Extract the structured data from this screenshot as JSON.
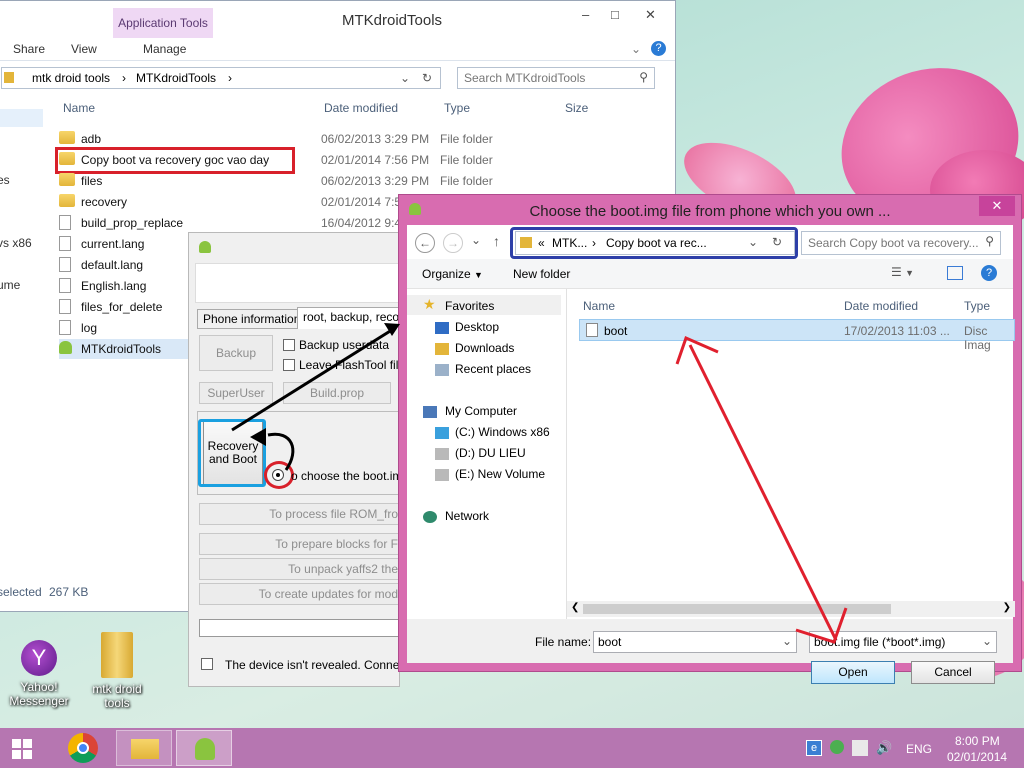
{
  "explorer": {
    "app_tools": "Application Tools",
    "title": "MTKdroidTools",
    "ribbon": {
      "share": "Share",
      "view": "View",
      "manage": "Manage"
    },
    "breadcrumb": {
      "part1": "mtk droid tools",
      "part2": "MTKdroidTools"
    },
    "search_placeholder": "Search MTKdroidTools",
    "columns": {
      "name": "Name",
      "date": "Date modified",
      "type": "Type",
      "size": "Size"
    },
    "rows": [
      {
        "name": "adb",
        "date": "06/02/2013 3:29 PM",
        "type": "File folder"
      },
      {
        "name": "Copy boot va recovery goc vao day",
        "date": "02/01/2014 7:56 PM",
        "type": "File folder"
      },
      {
        "name": "files",
        "date": "06/02/2013 3:29 PM",
        "type": "File folder"
      },
      {
        "name": "recovery",
        "date": "02/01/2014 7:5",
        "type": ""
      },
      {
        "name": "build_prop_replace",
        "date": "16/04/2012 9:4",
        "type": ""
      },
      {
        "name": "current.lang",
        "date": "",
        "type": ""
      },
      {
        "name": "default.lang",
        "date": "",
        "type": ""
      },
      {
        "name": "English.lang",
        "date": "",
        "type": ""
      },
      {
        "name": "files_for_delete",
        "date": "",
        "type": ""
      },
      {
        "name": "log",
        "date": "",
        "type": ""
      },
      {
        "name": "MTKdroidTools",
        "date": "",
        "type": ""
      }
    ],
    "side_cut": {
      "a": "es",
      "b": "vs x86",
      "c": "ume"
    },
    "status": {
      "selected": "selected",
      "size": "267 KB"
    }
  },
  "mtk": {
    "tabs": {
      "phone_info": "Phone information",
      "root": "root, backup, recove"
    },
    "backup": "Backup",
    "cb_userdata": "Backup userdata",
    "cb_flashtool": "Leave FlashTool files",
    "superuser": "SuperUser",
    "buildprop": "Build.prop",
    "recovery_boot_1": "Recovery",
    "recovery_boot_2": "and Boot",
    "choose_text": "o choose the boot.img",
    "process_rom": "To process file ROM_fro",
    "prepare_blocks": "To prepare blocks for F",
    "unpack": "To unpack yaffs2 the",
    "create_updates": "To create updates for mod",
    "device_status": "The device isn't revealed. Connect o"
  },
  "dialog": {
    "title": "Choose the boot.img file from phone which you own ...",
    "close": "✕",
    "path_prefix": "«",
    "path_1": "MTK...",
    "path_2": "Copy boot va rec...",
    "search_placeholder": "Search Copy boot va recovery...",
    "organize": "Organize",
    "new_folder": "New folder",
    "nav": {
      "favorites": "Favorites",
      "desktop": "Desktop",
      "downloads": "Downloads",
      "recent": "Recent places",
      "mycomputer": "My Computer",
      "c": "(C:) Windows x86",
      "d": "(D:) DU LIEU",
      "e": "(E:) New Volume",
      "network": "Network"
    },
    "columns": {
      "name": "Name",
      "date": "Date modified",
      "type": "Type"
    },
    "file": {
      "name": "boot",
      "date": "17/02/2013 11:03 ...",
      "type": "Disc Imag"
    },
    "filename_label": "File name:",
    "filename_value": "boot",
    "filter": "boot.img file (*boot*.img)",
    "open": "Open",
    "cancel": "Cancel"
  },
  "desktop": {
    "yahoo_1": "Yahoo!",
    "yahoo_2": "Messenger",
    "mtk_1": "mtk droid",
    "mtk_2": "tools"
  },
  "taskbar": {
    "lang": "ENG",
    "time": "8:00 PM",
    "date": "02/01/2014"
  }
}
